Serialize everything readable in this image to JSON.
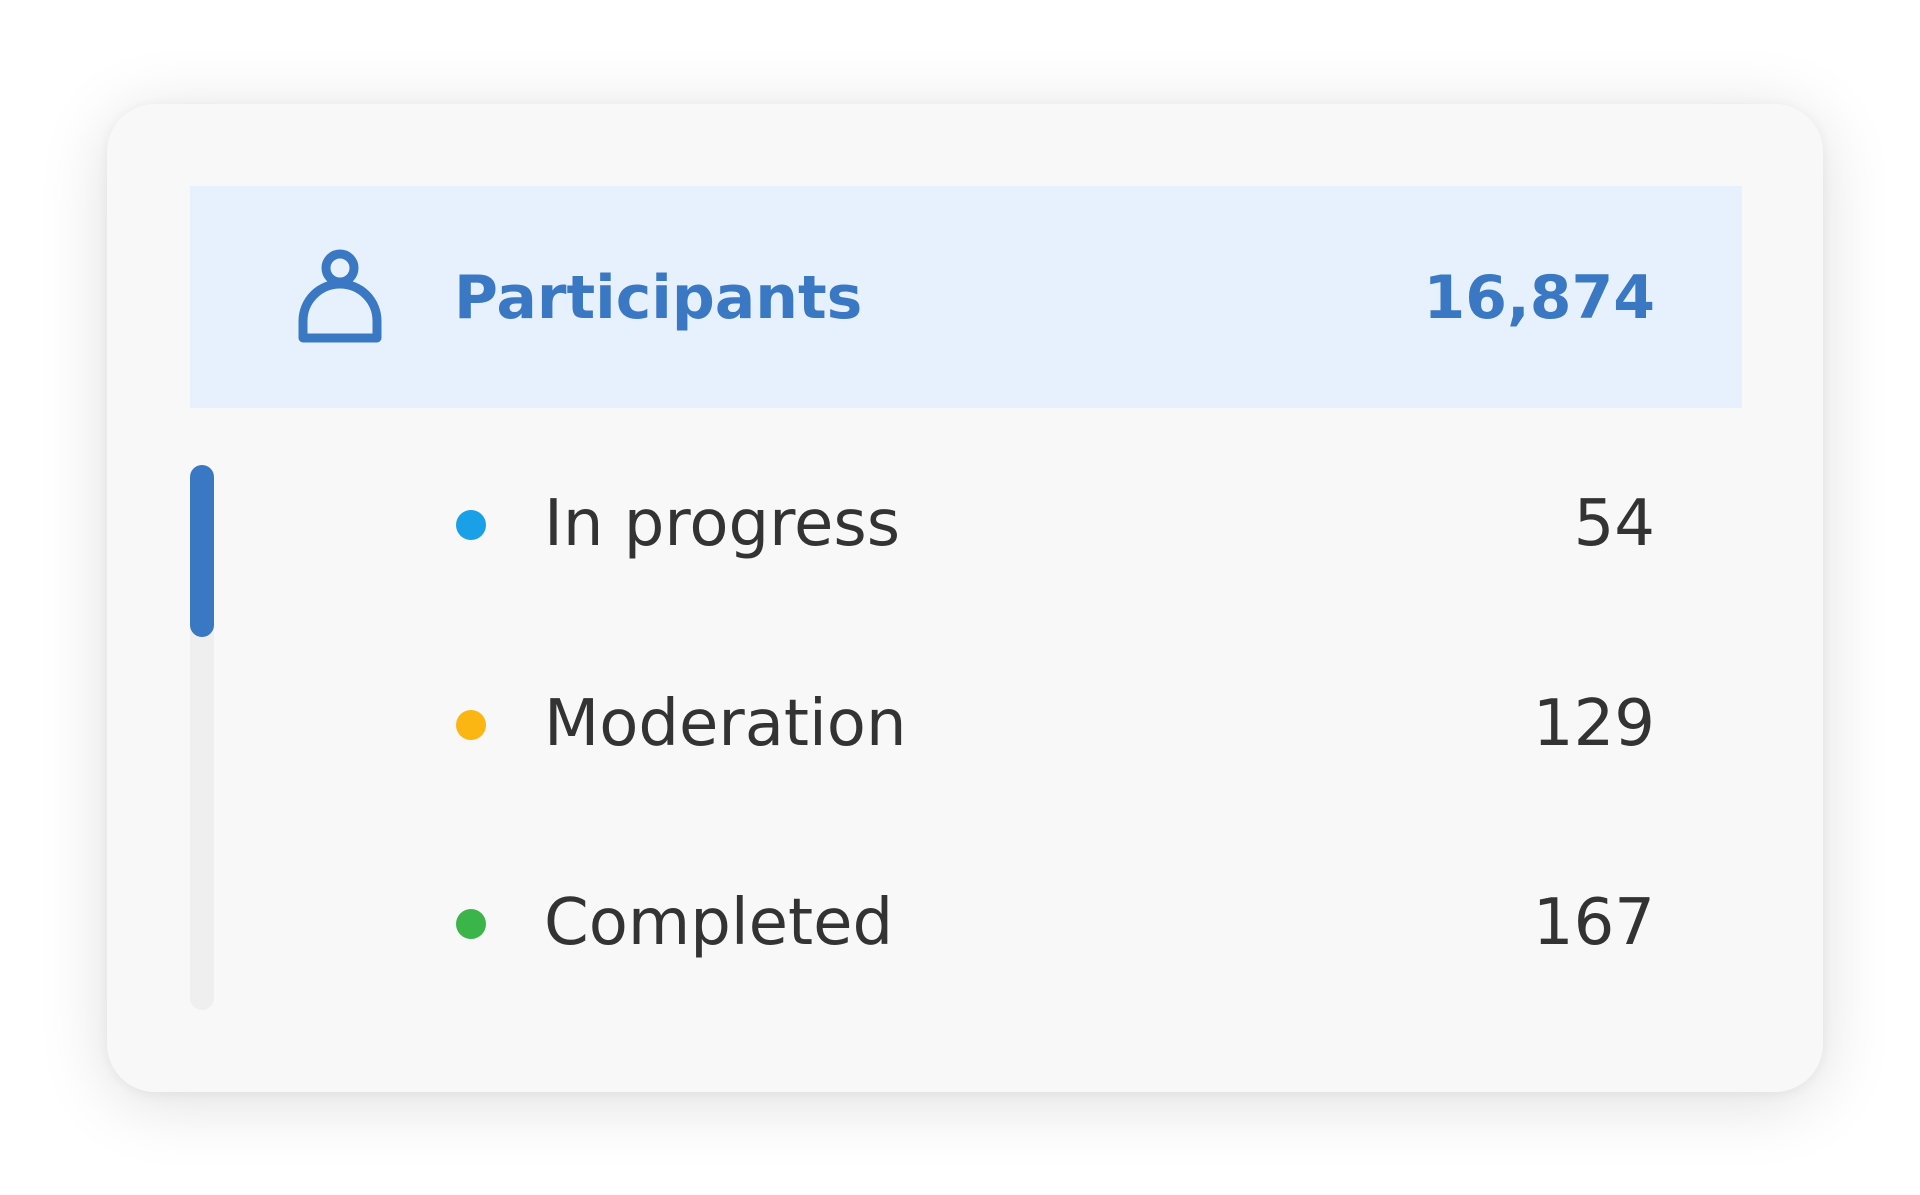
{
  "header": {
    "icon": "user-icon",
    "label": "Participants",
    "count": "16,874",
    "accent_color": "#3b78c4",
    "background_color": "#e7f1fd"
  },
  "statuses": [
    {
      "label": "In progress",
      "count": "54",
      "color": "#1aa0e6"
    },
    {
      "label": "Moderation",
      "count": "129",
      "color": "#fbb614"
    },
    {
      "label": "Completed",
      "count": "167",
      "color": "#3bb54a"
    }
  ],
  "scrollbar": {
    "thumb_color": "#3b78c4",
    "track_color": "#efefef"
  }
}
